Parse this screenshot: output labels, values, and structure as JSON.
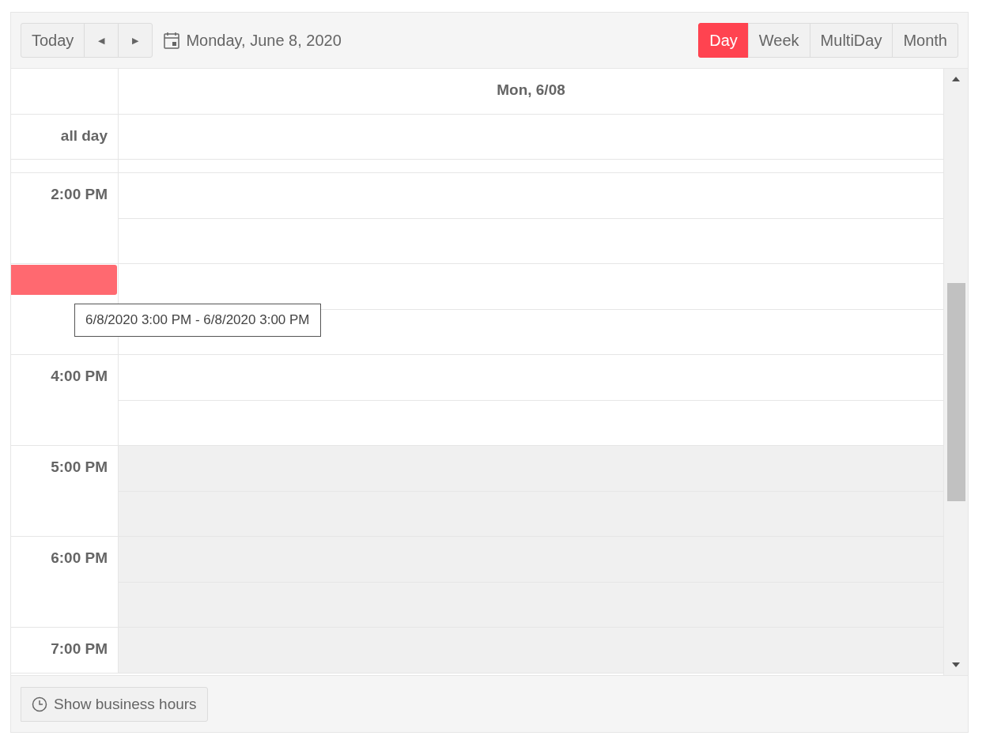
{
  "toolbar": {
    "today": "Today",
    "prev": "◀",
    "next": "▶",
    "date": "Monday, June 8, 2020",
    "views": [
      {
        "label": "Day",
        "selected": true
      },
      {
        "label": "Week",
        "selected": false
      },
      {
        "label": "MultiDay",
        "selected": false
      },
      {
        "label": "Month",
        "selected": false
      }
    ]
  },
  "header": {
    "day": "Mon, 6/08"
  },
  "all_day": {
    "label": "all day"
  },
  "hours": [
    {
      "label": "2:00 PM",
      "slots": [
        {
          "nonwork": false
        },
        {
          "nonwork": false
        }
      ]
    },
    {
      "slots": [
        {
          "nonwork": false
        },
        {
          "nonwork": false
        }
      ]
    },
    {
      "label": "4:00 PM",
      "slots": [
        {
          "nonwork": false
        },
        {
          "nonwork": false
        }
      ]
    },
    {
      "label": "5:00 PM",
      "slots": [
        {
          "nonwork": true
        },
        {
          "nonwork": true
        }
      ]
    },
    {
      "label": "6:00 PM",
      "slots": [
        {
          "nonwork": true
        },
        {
          "nonwork": true
        }
      ]
    },
    {
      "label": "7:00 PM",
      "slots": [
        {
          "nonwork": true
        }
      ]
    }
  ],
  "drag_tooltip": "6/8/2020 3:00 PM - 6/8/2020 3:00 PM",
  "footer": {
    "business_hours": "Show business hours"
  }
}
